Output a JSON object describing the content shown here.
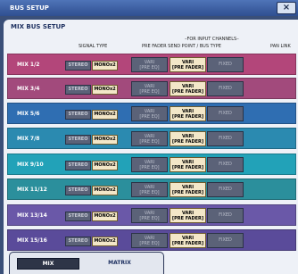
{
  "window": {
    "title": "BUS SETUP",
    "close_glyph": "×"
  },
  "panel": {
    "title": "MIX BUS SETUP",
    "headers": {
      "signal_type": "SIGNAL TYPE",
      "for_input_channels": "FOR INPUT CHANNELS",
      "send_point": "PRE FADER SEND POINT / BUS TYPE",
      "pan_link": "PAN LINK"
    }
  },
  "buttons": {
    "stereo": "STEREO",
    "mono": "MONOx2",
    "vari_pre_line1": "VARI",
    "vari_pre_line2": "[PRE EQ]",
    "vari_post_line1": "VARI",
    "vari_post_line2": "[PRE FADER]",
    "fixed": "FIXED"
  },
  "rows": [
    {
      "name": "MIX 1/2",
      "color": "#b3467a"
    },
    {
      "name": "MIX 3/4",
      "color": "#a24a7c"
    },
    {
      "name": "MIX 5/6",
      "color": "#2f6eb2"
    },
    {
      "name": "MIX 7/8",
      "color": "#2b8ab0"
    },
    {
      "name": "MIX 9/10",
      "color": "#22a2b8"
    },
    {
      "name": "MIX 11/12",
      "color": "#2b8f9c"
    },
    {
      "name": "MIX 13/14",
      "color": "#6a58a8"
    },
    {
      "name": "MIX 15/16",
      "color": "#5a4b9a"
    }
  ],
  "tabs": [
    {
      "label": "MIX",
      "selected": true
    },
    {
      "label": "MATRIX",
      "selected": false
    }
  ],
  "colors": {
    "title_bar": "#3f62a6",
    "selected": "#f3e7c8",
    "unselected": "#5b6278"
  }
}
